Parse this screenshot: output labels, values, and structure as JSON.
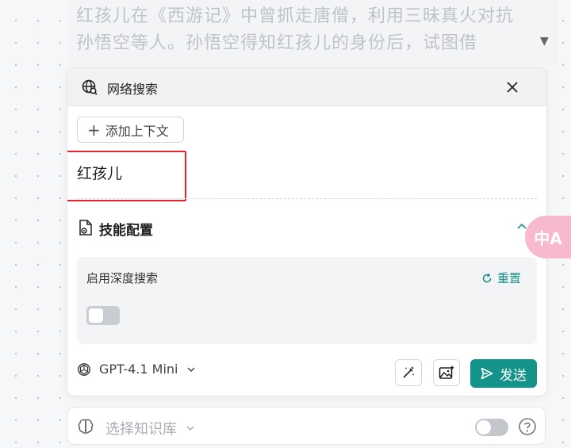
{
  "background_text": "红孩儿在《西游记》中曾抓走唐僧，利用三昧真火对抗孙悟空等人。孙悟空得知红孩儿的身份后，试图借",
  "panel": {
    "title": "网络搜索",
    "add_context_label": "添加上下文",
    "query": "红孩儿",
    "skill_section_title": "技能配置",
    "deep_search_label": "启用深度搜索",
    "reset_label": "重置",
    "deep_search_enabled": false,
    "model_name": "GPT-4.1 Mini",
    "send_label": "发送"
  },
  "knowledge_bar": {
    "placeholder": "选择知识库",
    "enabled": false
  },
  "translate_fab": {
    "label": "中A"
  },
  "colors": {
    "accent": "#13938a",
    "highlight_box": "#e0242a",
    "fab": "#f6b9cd"
  },
  "icons": [
    "globe-search-icon",
    "close-icon",
    "plus-icon",
    "skill-config-icon",
    "chevron-up-icon",
    "refresh-icon",
    "openai-icon",
    "chevron-down-icon",
    "magic-wand-icon",
    "image-icon",
    "send-icon",
    "brain-icon",
    "help-icon",
    "translate-icon"
  ]
}
